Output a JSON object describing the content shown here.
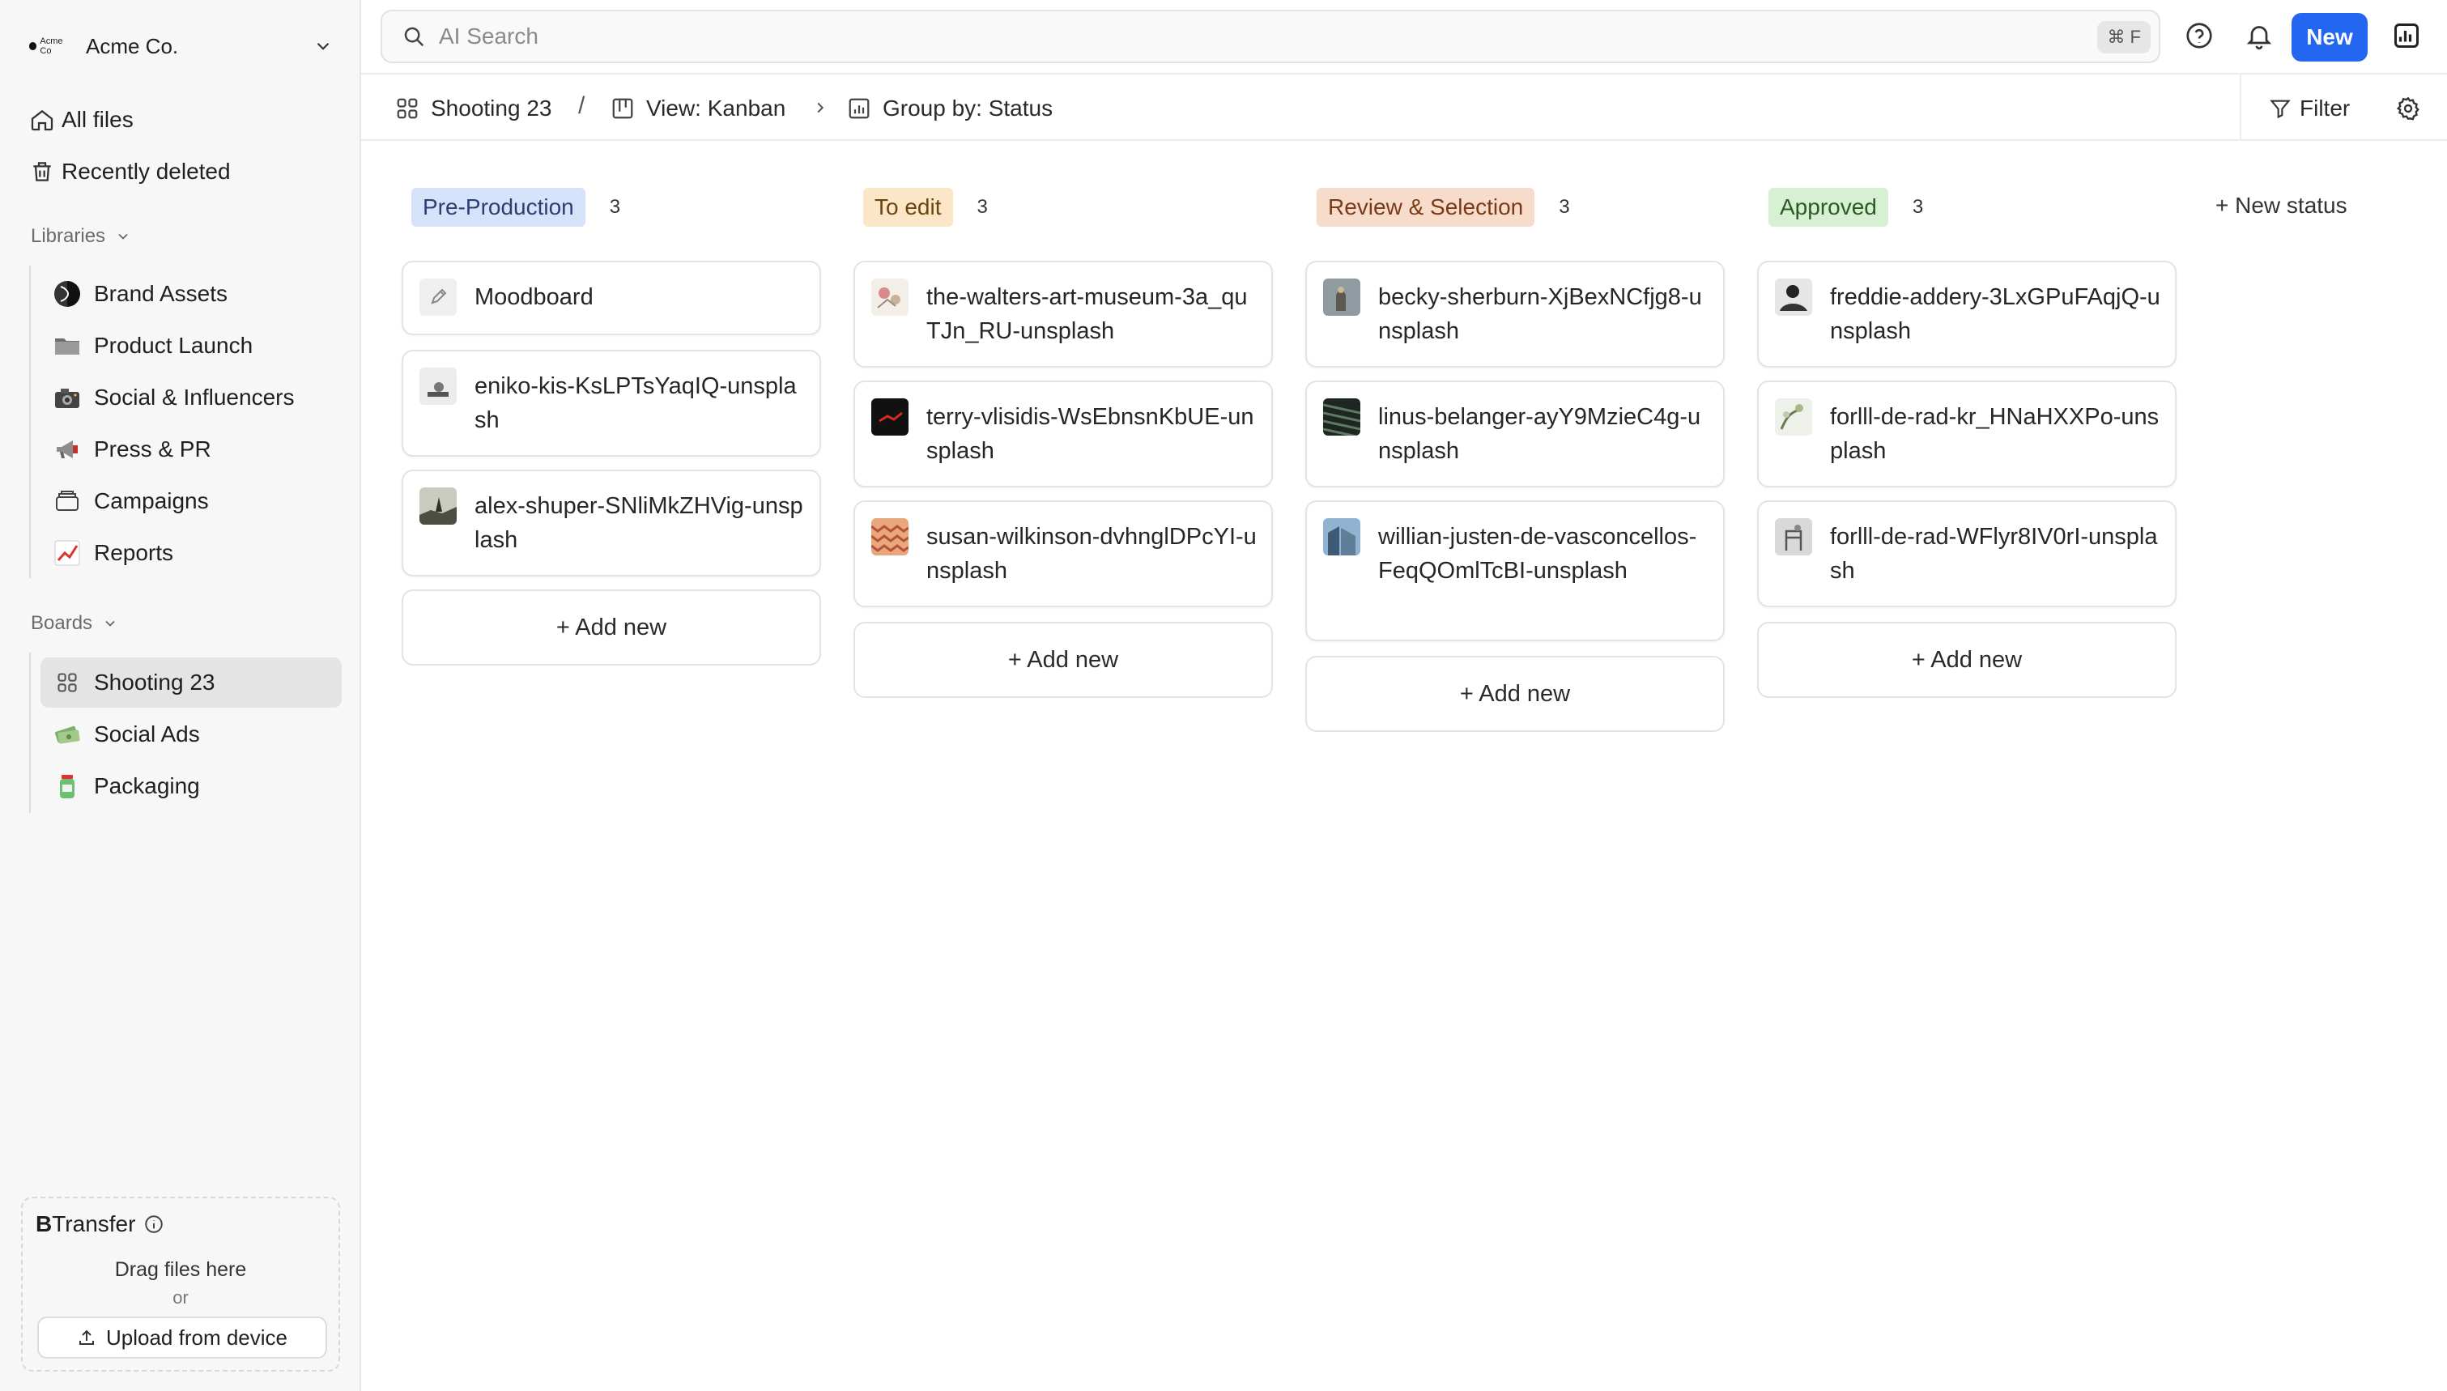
{
  "workspace": {
    "name": "Acme Co.",
    "logo_text": "Acme Co"
  },
  "nav": {
    "all_files": "All files",
    "recently_deleted": "Recently deleted"
  },
  "libraries": {
    "label": "Libraries",
    "items": [
      {
        "label": "Brand Assets",
        "icon": "half-circle-icon"
      },
      {
        "label": "Product Launch",
        "icon": "folder-icon"
      },
      {
        "label": "Social & Influencers",
        "icon": "camera-icon"
      },
      {
        "label": "Press & PR",
        "icon": "megaphone-icon"
      },
      {
        "label": "Campaigns",
        "icon": "stack-icon"
      },
      {
        "label": "Reports",
        "icon": "chart-icon"
      }
    ]
  },
  "boards": {
    "label": "Boards",
    "items": [
      {
        "label": "Shooting 23",
        "icon": "grid-icon"
      },
      {
        "label": "Social Ads",
        "icon": "money-icon"
      },
      {
        "label": "Packaging",
        "icon": "jar-icon"
      }
    ]
  },
  "transfer": {
    "brand_b": "B",
    "brand_rest": "Transfer",
    "drag_text": "Drag files here",
    "or_text": "or",
    "upload_label": "Upload from device"
  },
  "topbar": {
    "search_placeholder": "AI Search",
    "shortcut": "⌘ F",
    "new_label": "New"
  },
  "breadcrumb": {
    "board": "Shooting 23",
    "separator": "/",
    "view": "View: Kanban",
    "group": "Group by: Status",
    "filter": "Filter"
  },
  "board": {
    "new_status": "+ New status",
    "add_new": "+ Add new",
    "columns": [
      {
        "status": "Pre-Production",
        "count": "3",
        "bg": "#d6e4fb",
        "fg": "#2b3f73",
        "cards": [
          {
            "title": "Moodboard",
            "thumb": "edit-icon"
          },
          {
            "title": "eniko-kis-KsLPTsYaqIQ-unsplash",
            "thumb": "photo"
          },
          {
            "title": "alex-shuper-SNliMkZHVig-unsplash",
            "thumb": "photo"
          }
        ]
      },
      {
        "status": "To edit",
        "count": "3",
        "bg": "#fbe6c8",
        "fg": "#6b4410",
        "cards": [
          {
            "title": "the-walters-art-museum-3a_quTJn_RU-unsplash",
            "thumb": "photo"
          },
          {
            "title": "terry-vlisidis-WsEbnsnKbUE-unsplash",
            "thumb": "photo"
          },
          {
            "title": "susan-wilkinson-dvhnglDPcYI-unsplash",
            "thumb": "photo"
          }
        ]
      },
      {
        "status": "Review & Selection",
        "count": "3",
        "bg": "#f8dccb",
        "fg": "#7a3a18",
        "cards": [
          {
            "title": "becky-sherburn-XjBexNCfjg8-unsplash",
            "thumb": "photo"
          },
          {
            "title": "linus-belanger-ayY9MzieC4g-unsplash",
            "thumb": "photo"
          },
          {
            "title": "willian-justen-de-vasconcellos-FeqQOmlTcBI-unsplash",
            "thumb": "photo"
          }
        ]
      },
      {
        "status": "Approved",
        "count": "3",
        "bg": "#d7efd3",
        "fg": "#2c5a25",
        "cards": [
          {
            "title": "freddie-addery-3LxGPuFAqjQ-unsplash",
            "thumb": "photo"
          },
          {
            "title": "forlll-de-rad-kr_HNaHXXPo-unsplash",
            "thumb": "photo"
          },
          {
            "title": "forlll-de-rad-WFlyr8IV0rI-unsplash",
            "thumb": "photo"
          }
        ]
      }
    ]
  },
  "colors": {
    "accent": "#2366f0",
    "sidebar_bg": "#f7f7f7",
    "active_item": "#e4e4e4"
  }
}
